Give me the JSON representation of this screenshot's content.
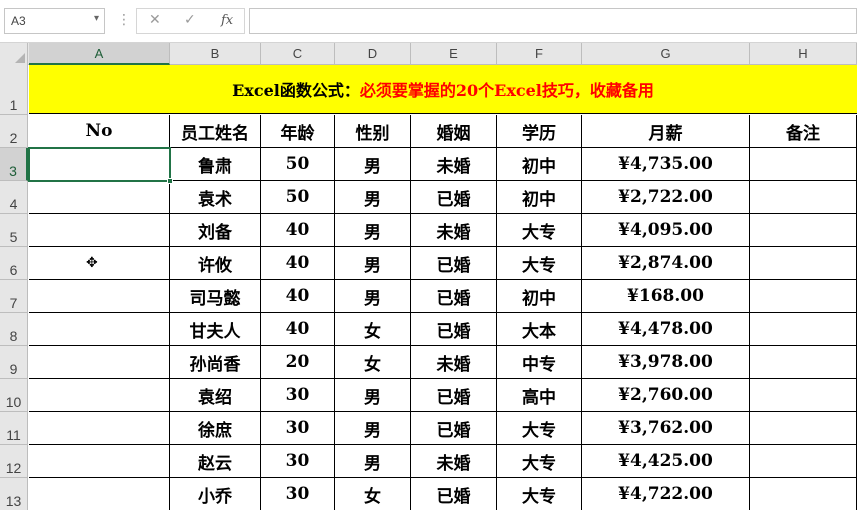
{
  "formula_bar": {
    "name_box": "A3",
    "name_box_arrow": "▾",
    "separator": "⋮",
    "cancel_icon": "✕",
    "enter_icon": "✓",
    "fx_label": "fx",
    "formula": ""
  },
  "columns": [
    "A",
    "B",
    "C",
    "D",
    "E",
    "F",
    "G",
    "H"
  ],
  "rows": [
    "1",
    "2",
    "3",
    "4",
    "5",
    "6",
    "7",
    "8",
    "9",
    "10",
    "11",
    "12",
    "13"
  ],
  "title": {
    "part1": "Excel函数公式：",
    "part2": "必须要掌握的20个Excel技巧，收藏备用",
    "color_part1": "#000000",
    "color_part2": "#ff0000",
    "background": "#ffff00"
  },
  "table": {
    "headers": [
      "No",
      "员工姓名",
      "年龄",
      "性别",
      "婚姻",
      "学历",
      "月薪",
      "备注"
    ],
    "rows": [
      [
        "",
        "鲁肃",
        "50",
        "男",
        "未婚",
        "初中",
        "¥4,735.00",
        ""
      ],
      [
        "",
        "袁术",
        "50",
        "男",
        "已婚",
        "初中",
        "¥2,722.00",
        ""
      ],
      [
        "",
        "刘备",
        "40",
        "男",
        "未婚",
        "大专",
        "¥4,095.00",
        ""
      ],
      [
        "",
        "许攸",
        "40",
        "男",
        "已婚",
        "大专",
        "¥2,874.00",
        ""
      ],
      [
        "",
        "司马懿",
        "40",
        "男",
        "已婚",
        "初中",
        "¥168.00",
        ""
      ],
      [
        "",
        "甘夫人",
        "40",
        "女",
        "已婚",
        "大本",
        "¥4,478.00",
        ""
      ],
      [
        "",
        "孙尚香",
        "20",
        "女",
        "未婚",
        "中专",
        "¥3,978.00",
        ""
      ],
      [
        "",
        "袁绍",
        "30",
        "男",
        "已婚",
        "高中",
        "¥2,760.00",
        ""
      ],
      [
        "",
        "徐庶",
        "30",
        "男",
        "已婚",
        "大专",
        "¥3,762.00",
        ""
      ],
      [
        "",
        "赵云",
        "30",
        "男",
        "未婚",
        "大专",
        "¥4,425.00",
        ""
      ],
      [
        "",
        "小乔",
        "30",
        "女",
        "已婚",
        "大专",
        "¥4,722.00",
        ""
      ]
    ]
  },
  "selected_cell": "A3",
  "accent_color": "#217346",
  "cursor_icon": "move-cross-icon"
}
